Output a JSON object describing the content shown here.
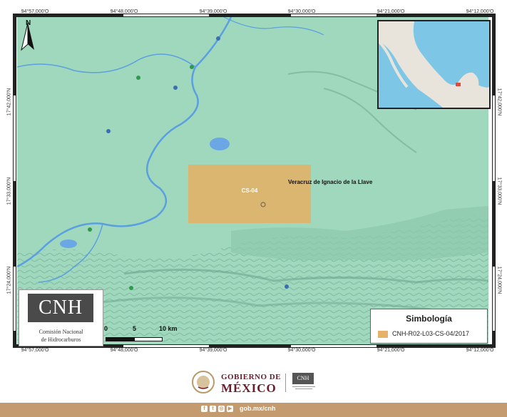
{
  "map": {
    "top_coords": [
      "94°57,000'O",
      "94°48,000'O",
      "94°39,000'O",
      "94°30,000'O",
      "94°21,000'O",
      "94°12,000'O"
    ],
    "bottom_coords": [
      "94°57,000'O",
      "94°48,000'O",
      "94°39,000'O",
      "94°30,000'O",
      "94°21,000'O",
      "94°12,000'O"
    ],
    "left_coords": [
      "17°42,000'N",
      "17°33,000'N",
      "17°24,000'N"
    ],
    "right_coords": [
      "17°42,000'N",
      "17°33,000'N",
      "17°24,000'N"
    ],
    "north_label": "N",
    "area_label": "CS-04",
    "state_label": "Veracruz de Ignacio de la Llave",
    "colors": {
      "land": "#9fd8bd",
      "river": "#5b9fe0",
      "study_area": "#e6b168",
      "relief": "#7fbba2"
    }
  },
  "cnh_box": {
    "logo": "CNH",
    "line1": "Comisión Nacional",
    "line2": "de Hidrocarburos"
  },
  "scale": {
    "labels": [
      "0",
      "5",
      "10 km"
    ]
  },
  "legend": {
    "title": "Simbología",
    "entry": "CNH-R02-L03-CS-04/2017"
  },
  "footer": {
    "gob_line1": "GOBIERNO DE",
    "gob_line2": "MÉXICO",
    "cnh_small": "CNH",
    "url": "gob.mx/cnh",
    "icons": [
      "facebook-icon",
      "twitter-icon",
      "instagram-icon",
      "youtube-icon"
    ]
  }
}
